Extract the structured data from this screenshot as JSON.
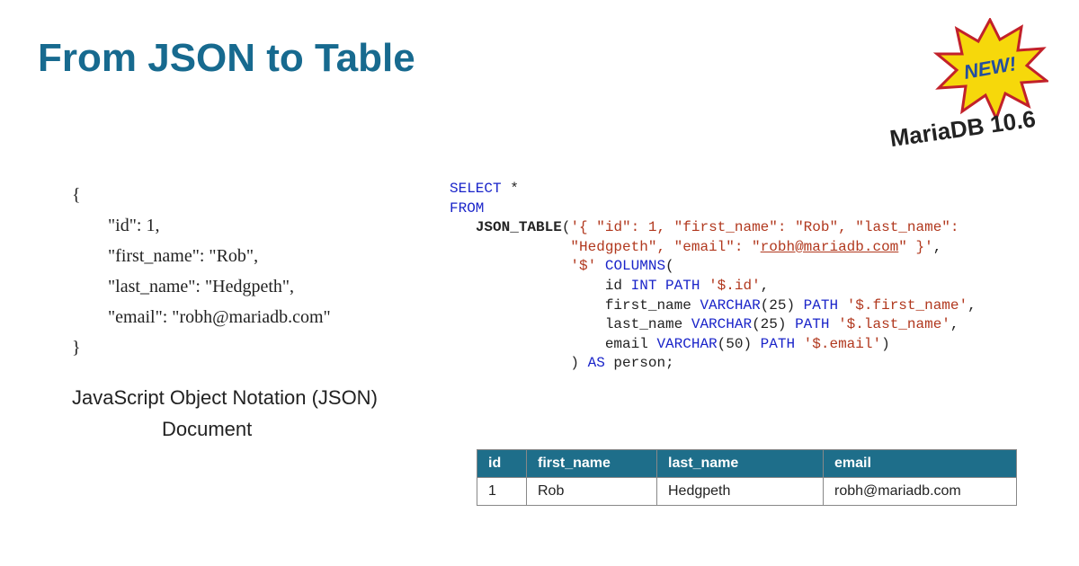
{
  "title": "From JSON to Table",
  "badge": {
    "text": "NEW!",
    "version": "MariaDB 10.6"
  },
  "json_doc": {
    "open": "{",
    "lines": [
      "\"id\": 1,",
      "\"first_name\": \"Rob\",",
      "\"last_name\": \"Hedgpeth\",",
      "\"email\": \"robh@mariadb.com\""
    ],
    "close": "}",
    "label_line1": "JavaScript Object Notation (JSON)",
    "label_line2": "Document"
  },
  "sql": {
    "kw_select": "SELECT",
    "star": " *",
    "kw_from": "FROM",
    "fn_json_table": "JSON_TABLE",
    "lparen": "(",
    "arg_json_a": "'{ \"id\": 1, \"first_name\": \"Rob\", \"last_name\":",
    "arg_json_b_pre": "\"Hedgpeth\", \"email\": \"",
    "arg_json_email": "robh@mariadb.com",
    "arg_json_b_post": "\" }'",
    "comma": ",",
    "root_path": "'$'",
    "kw_columns": " COLUMNS",
    "lparen2": "(",
    "col_id_name": "id ",
    "kw_int": "INT",
    "kw_path": " PATH ",
    "path_id": "'$.id'",
    "col_fn_name": "first_name ",
    "kw_varchar25": "VARCHAR",
    "v25": "(25)",
    "path_fn": "'$.first_name'",
    "col_ln_name": "last_name ",
    "path_ln": "'$.last_name'",
    "col_em_name": "email ",
    "v50": "(50)",
    "path_em": "'$.email'",
    "rparen2": ")",
    "rparen": ") ",
    "kw_as": "AS",
    "alias": " person;"
  },
  "table": {
    "headers": [
      "id",
      "first_name",
      "last_name",
      "email"
    ],
    "row": [
      "1",
      "Rob",
      "Hedgpeth",
      "robh@mariadb.com"
    ]
  }
}
